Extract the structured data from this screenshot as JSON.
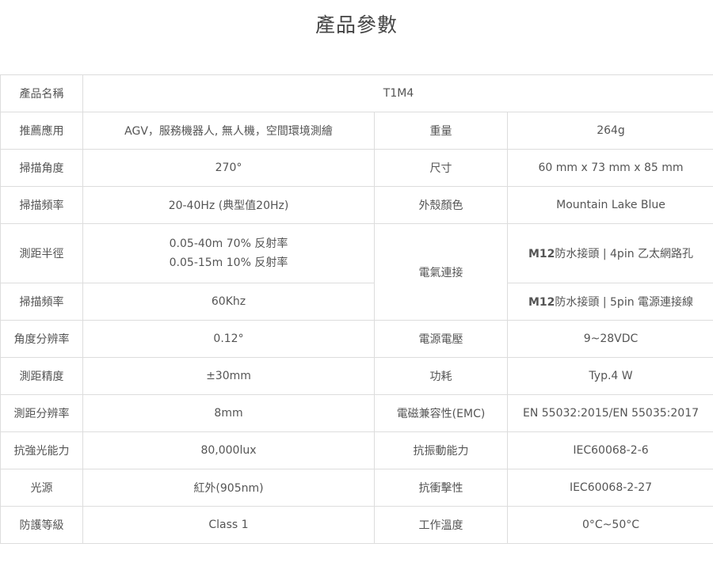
{
  "title": "產品參數",
  "rows": {
    "name": {
      "label": "產品名稱",
      "value": "T1M4"
    },
    "app": {
      "label": "推薦應用",
      "value": "AGV，服務機器人, 無人機，空間環境測繪",
      "label2": "重量",
      "value2": "264g"
    },
    "angle": {
      "label": "掃描角度",
      "value": "270°",
      "label2": "尺寸",
      "value2": "60 mm x 73 mm x 85 mm"
    },
    "freq": {
      "label": "掃描頻率",
      "value": "20-40Hz (典型值20Hz)",
      "label2": "外殼顏色",
      "value2": "Mountain Lake Blue"
    },
    "range": {
      "label": "測距半徑",
      "value_line1": "0.05-40m 70% 反射率",
      "value_line2": "0.05-15m 10% 反射率",
      "label2": "電氣連接",
      "conn1_prefix": "M12",
      "conn1_text": "防水接頭 | 4pin 乙太網路孔"
    },
    "scan": {
      "label": "掃描頻率",
      "value": "60Khz",
      "conn2_prefix": "M12",
      "conn2_text": "防水接頭 | 5pin 電源連接線"
    },
    "angres": {
      "label": "角度分辨率",
      "value": "0.12°",
      "label2": "電源電壓",
      "value2": "9~28VDC"
    },
    "acc": {
      "label": "測距精度",
      "value": "±30mm",
      "label2": "功耗",
      "value2": "Typ.4 W"
    },
    "rres": {
      "label": "測距分辨率",
      "value": "8mm",
      "label2": "電磁兼容性(EMC)",
      "value2": "EN 55032:2015/EN 55035:2017"
    },
    "light": {
      "label": "抗強光能力",
      "value": "80,000lux",
      "label2": "抗振動能力",
      "value2": "IEC60068-2-6"
    },
    "source": {
      "label": "光源",
      "value": "紅外(905nm)",
      "label2": "抗衝擊性",
      "value2": "IEC60068-2-27"
    },
    "ip": {
      "label": "防護等級",
      "value": "Class 1",
      "label2": "工作溫度",
      "value2": "0°C~50°C"
    }
  }
}
